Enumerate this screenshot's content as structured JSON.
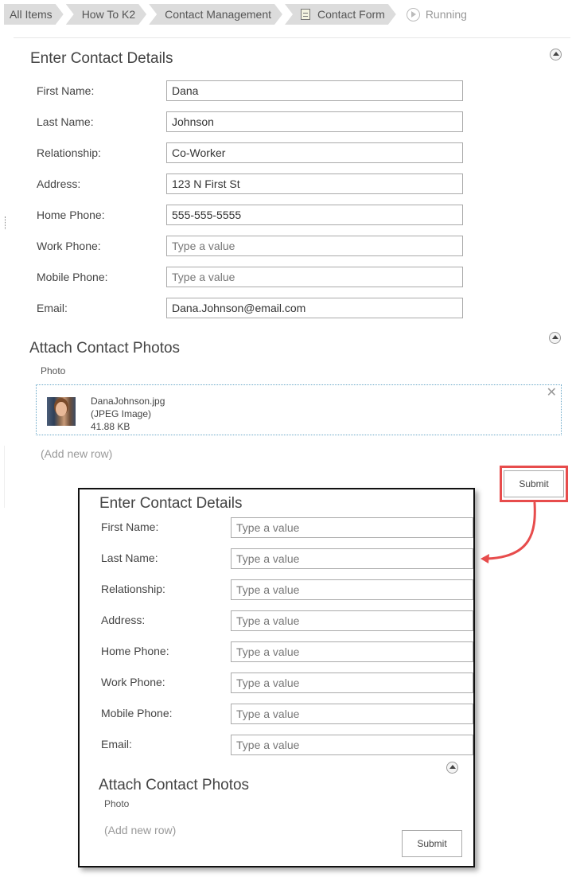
{
  "breadcrumb": {
    "items": [
      "All Items",
      "How To K2",
      "Contact Management",
      "Contact Form"
    ],
    "current": "Running"
  },
  "form": {
    "details_title": "Enter Contact Details",
    "fields": [
      {
        "label": "First Name:",
        "value": "Dana",
        "placeholder": "Type a value"
      },
      {
        "label": "Last Name:",
        "value": "Johnson",
        "placeholder": "Type a value"
      },
      {
        "label": "Relationship:",
        "value": "Co-Worker",
        "placeholder": "Type a value"
      },
      {
        "label": "Address:",
        "value": "123 N First St",
        "placeholder": "Type a value"
      },
      {
        "label": "Home Phone:",
        "value": "555-555-5555",
        "placeholder": "Type a value"
      },
      {
        "label": "Work Phone:",
        "value": "",
        "placeholder": "Type a value"
      },
      {
        "label": "Mobile Phone:",
        "value": "",
        "placeholder": "Type a value"
      },
      {
        "label": "Email:",
        "value": "Dana.Johnson@email.com",
        "placeholder": "Type a value"
      }
    ],
    "photos_title": "Attach Contact Photos",
    "photo_column": "Photo",
    "attachment": {
      "name": "DanaJohnson.jpg",
      "type": "(JPEG Image)",
      "size": "41.88 KB"
    },
    "add_row": "(Add new row)",
    "submit": "Submit"
  },
  "cleared_form": {
    "details_title": "Enter Contact Details",
    "fields": [
      {
        "label": "First Name:",
        "placeholder": "Type a value"
      },
      {
        "label": "Last Name:",
        "placeholder": "Type a value"
      },
      {
        "label": "Relationship:",
        "placeholder": "Type a value"
      },
      {
        "label": "Address:",
        "placeholder": "Type a value"
      },
      {
        "label": "Home Phone:",
        "placeholder": "Type a value"
      },
      {
        "label": "Work Phone:",
        "placeholder": "Type a value"
      },
      {
        "label": "Mobile Phone:",
        "placeholder": "Type a value"
      },
      {
        "label": "Email:",
        "placeholder": "Type a value"
      }
    ],
    "photos_title": "Attach Contact Photos",
    "photo_column": "Photo",
    "add_row": "(Add new row)",
    "submit": "Submit"
  },
  "colors": {
    "highlight": "#e74c4c",
    "crumb_bg": "#dcdcdc"
  }
}
